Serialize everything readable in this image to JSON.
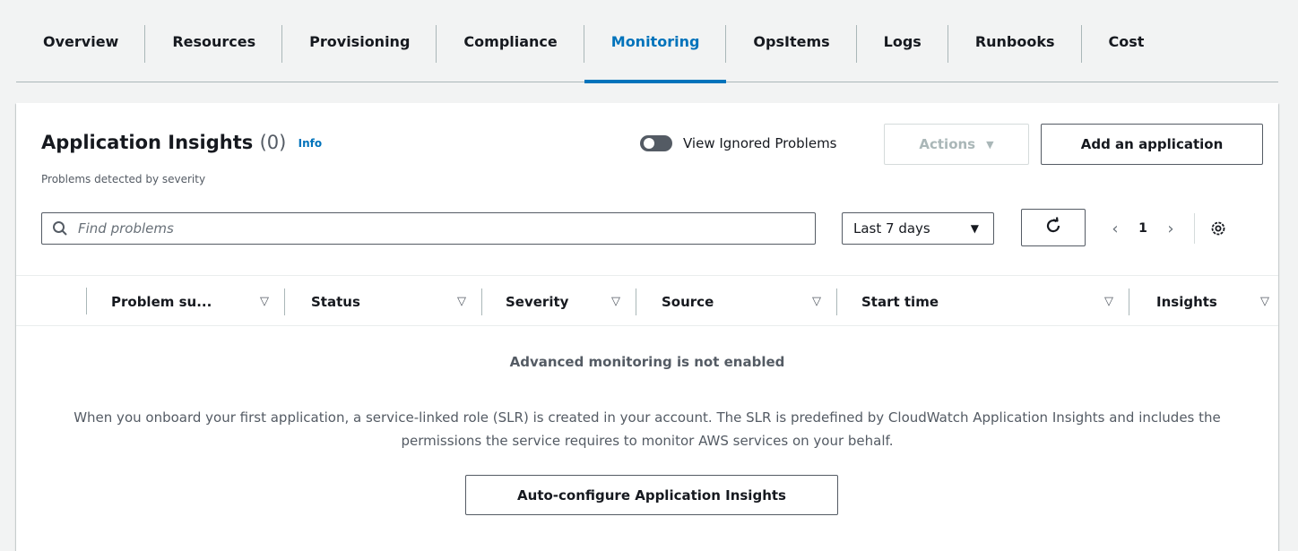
{
  "tabs": [
    {
      "label": "Overview",
      "active": false
    },
    {
      "label": "Resources",
      "active": false
    },
    {
      "label": "Provisioning",
      "active": false
    },
    {
      "label": "Compliance",
      "active": false
    },
    {
      "label": "Monitoring",
      "active": true
    },
    {
      "label": "OpsItems",
      "active": false
    },
    {
      "label": "Logs",
      "active": false
    },
    {
      "label": "Runbooks",
      "active": false
    },
    {
      "label": "Cost",
      "active": false
    }
  ],
  "panel": {
    "title": "Application Insights",
    "count": "(0)",
    "info_link": "Info",
    "subtitle": "Problems detected by severity",
    "toggle_label": "View Ignored Problems",
    "toggle_on": false,
    "actions_label": "Actions",
    "add_label": "Add an application",
    "search_placeholder": "Find problems",
    "range_label": "Last 7 days",
    "page_number": "1",
    "columns": [
      {
        "label": "Problem su..."
      },
      {
        "label": "Status"
      },
      {
        "label": "Severity"
      },
      {
        "label": "Source"
      },
      {
        "label": "Start time"
      },
      {
        "label": "Insights"
      }
    ],
    "empty_title": "Advanced monitoring is not enabled",
    "empty_desc": "When you onboard your first application, a service-linked role (SLR) is created in your account. The SLR is predefined by CloudWatch Application Insights and includes the permissions the service requires to monitor AWS services on your behalf.",
    "auto_configure_label": "Auto-configure Application Insights"
  },
  "colors": {
    "accent": "#0073bb",
    "text": "#16191f",
    "muted": "#545b64"
  },
  "icons": [
    "search-icon",
    "refresh-icon",
    "chevron-left-icon",
    "chevron-right-icon",
    "settings-icon",
    "caret-down-icon",
    "sort-icon"
  ]
}
